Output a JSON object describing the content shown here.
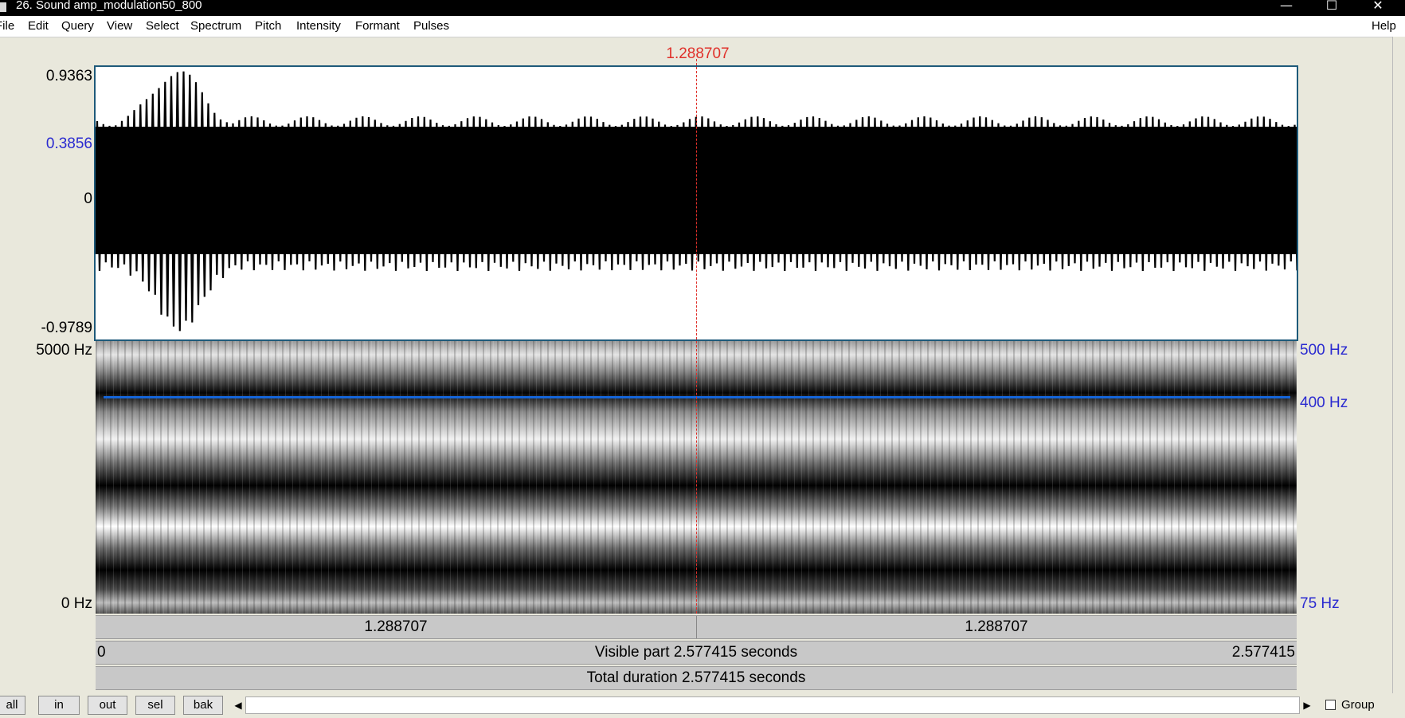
{
  "window": {
    "title": "26. Sound amp_modulation50_800",
    "minimize_glyph": "—",
    "maximize_glyph": "☐",
    "close_glyph": "✕"
  },
  "menu": {
    "items": [
      "File",
      "Edit",
      "Query",
      "View",
      "Select",
      "Spectrum",
      "Pitch",
      "Intensity",
      "Formant",
      "Pulses"
    ],
    "help": "Help"
  },
  "cursor": {
    "time_label": "1.288707",
    "time_seconds": 1.288707,
    "color": "#e0302a"
  },
  "waveform": {
    "max_label": "0.9363",
    "cursor_value_label": "0.3856",
    "zero_label": "0",
    "min_label": "-0.9789"
  },
  "spectrogram": {
    "top_freq_label": "5000 Hz",
    "bottom_freq_label": "0 Hz",
    "pitch_top_label": "500 Hz",
    "pitch_value_label": "400 Hz",
    "pitch_bottom_label": "75 Hz",
    "pitch_color": "#1565d8"
  },
  "time_bars": {
    "left_segment": "1.288707",
    "right_segment": "1.288707",
    "visible_start": "0",
    "visible_label": "Visible part 2.577415 seconds",
    "visible_end": "2.577415",
    "total_label": "Total duration 2.577415 seconds"
  },
  "bottom": {
    "buttons": [
      "all",
      "in",
      "out",
      "sel",
      "bak"
    ],
    "scroll_left_glyph": "◀",
    "scroll_right_glyph": "▶",
    "group_label": "Group",
    "group_checked": false
  }
}
